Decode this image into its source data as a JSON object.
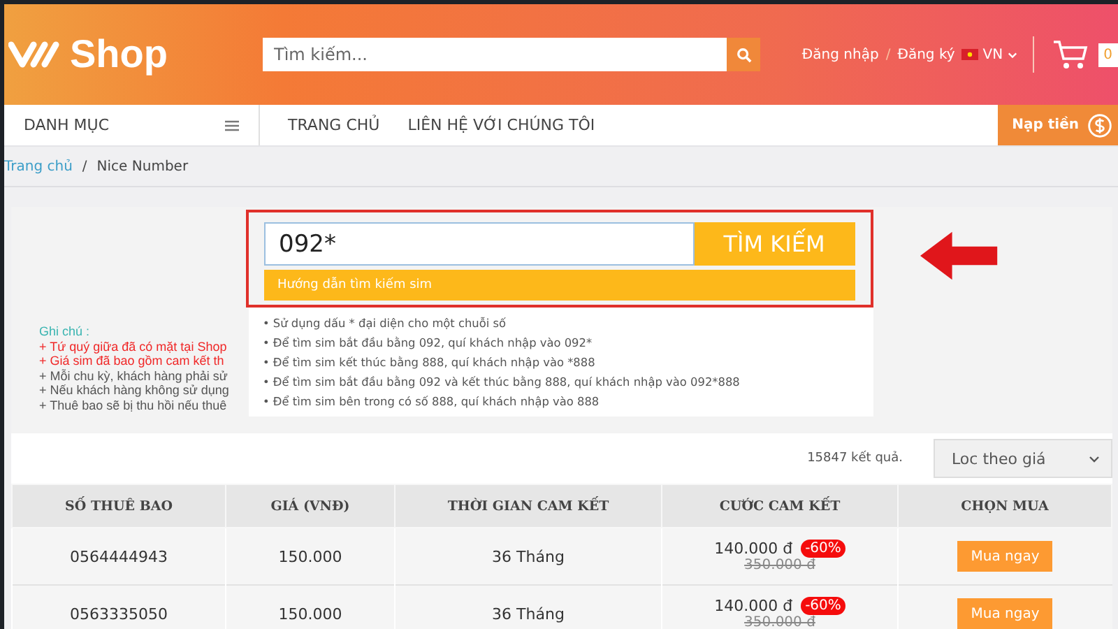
{
  "header": {
    "logo": "Shop",
    "search": {
      "placeholder": "Tìm kiếm..."
    },
    "login": "Đăng nhập",
    "separator": "/",
    "register": "Đăng ký",
    "language": "VN",
    "cart_count": "0"
  },
  "nav": {
    "category": "DANH MỤC",
    "links": [
      {
        "label": "TRANG CHỦ",
        "selected": false
      },
      {
        "label": "LIÊN HỆ VỚI CHÚNG TÔI",
        "selected": false
      }
    ],
    "topup": "Nạp tiền"
  },
  "breadcrumb": [
    "Trang chủ",
    "/",
    "Nice Number"
  ],
  "sim_search": {
    "value": "092*",
    "button": "TÌM KIẾM",
    "guide_title": "Hướng dẫn tìm kiếm sim",
    "guide_items": [
      "• Sử dụng dấu * đại diện cho một chuỗi số",
      "• Để tìm sim bắt đầu bằng 092, quí khách nhập vào 092*",
      "• Để tìm sim kết thúc bằng 888, quí khách nhập vào *888",
      "• Để tìm sim bắt đầu bằng 092 và kết thúc bằng 888, quí khách nhập vào 092*888",
      "• Để tìm sim bên trong có số 888, quí khách nhập vào 888"
    ]
  },
  "notes": {
    "title": "Ghi chú :",
    "items": [
      {
        "text": "+ Tứ quý giữa đã có mặt tại Shop",
        "kind": "highlight"
      },
      {
        "text": "+ Giá sim đã bao gồm cam kết th",
        "kind": "highlight"
      },
      {
        "text": "+ Mỗi chu kỳ, khách hàng phải sử",
        "kind": "normal"
      },
      {
        "text": "+ Nếu khách hàng không sử dụng",
        "kind": "normal"
      },
      {
        "text": "+ Thuê bao sẽ bị thu hồi nếu thuê",
        "kind": "normal"
      }
    ]
  },
  "results": {
    "count": "15847 kết quả.",
    "filter": "Loc theo giá"
  },
  "table": {
    "columns": [
      "SỐ THUÊ BAO",
      "GIÁ (VNĐ)",
      "THỜI GIAN CAM KẾT",
      "CƯỚC CAM KẾT",
      "CHỌN MUA"
    ],
    "rows": [
      {
        "number": "0564444943",
        "price": "150.000",
        "term": "36 Tháng",
        "fee": "140.000 đ",
        "discount": "-60%",
        "old_fee": "350.000 đ",
        "action": "Mua ngay"
      },
      {
        "number": "0563335050",
        "price": "150.000",
        "term": "36 Tháng",
        "fee": "140.000 đ",
        "discount": "-60%",
        "old_fee": "350.000 đ",
        "action": "Mua ngay"
      }
    ]
  }
}
